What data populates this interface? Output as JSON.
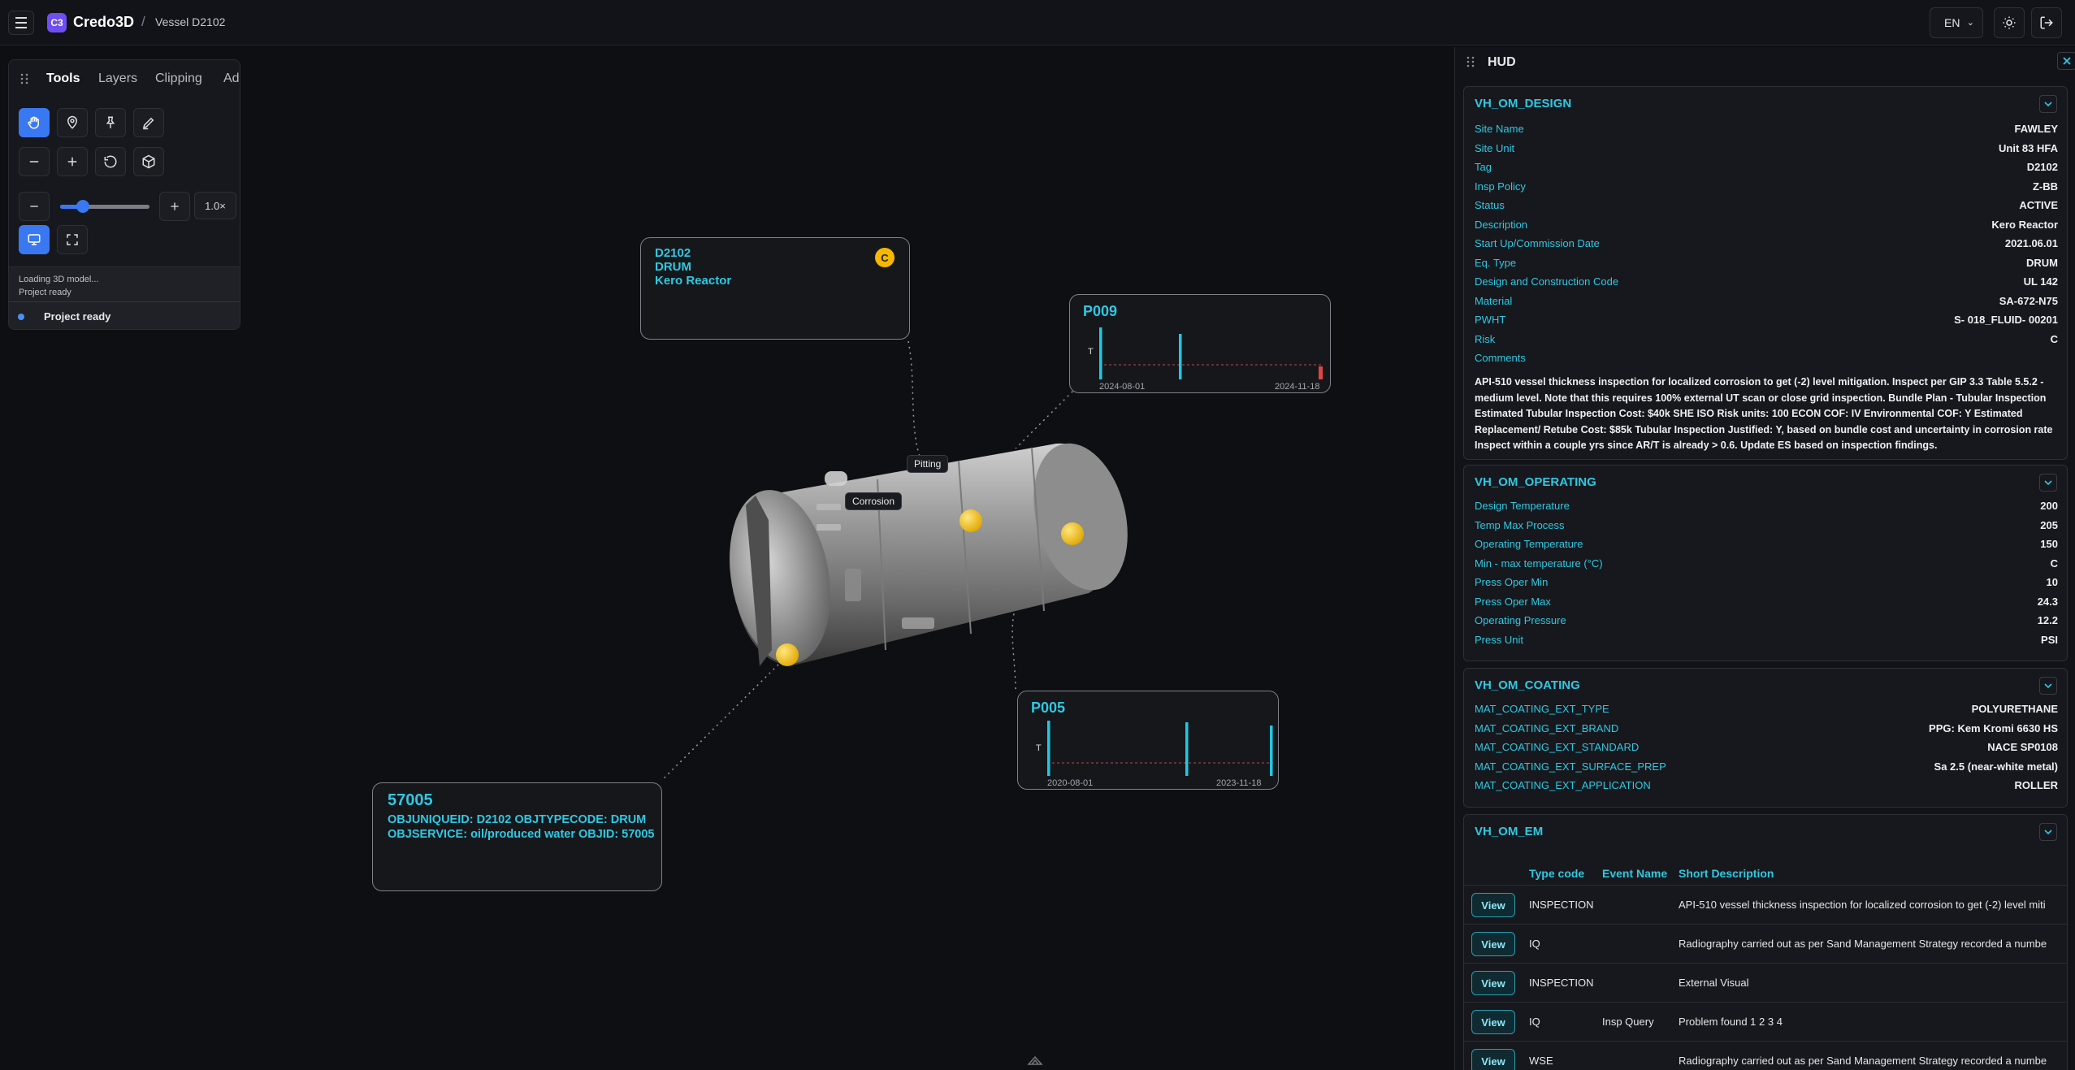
{
  "app": {
    "brand": "Credo3D",
    "breadcrumb": "Vessel D2102",
    "language": "EN",
    "logo_glyph": "C3",
    "accent": "#30c8e2",
    "primary": "#3a78f2"
  },
  "tools_panel": {
    "tabs": [
      "Tools",
      "Layers",
      "Clipping",
      "Ad"
    ],
    "zoom_value": "1.0×",
    "zoom_level_fraction": 0.25,
    "log": [
      "Loading 3D model...",
      "Project ready"
    ],
    "status": "Project ready",
    "icons": [
      "hand-icon",
      "location-pin-icon",
      "pin-icon",
      "pen-icon",
      "minus-icon",
      "plus-icon",
      "rotate-icon",
      "cube-icon",
      "monitor-icon",
      "fullscreen-icon"
    ]
  },
  "viewport": {
    "tags": {
      "pitting": "Pitting",
      "corrosion": "Corrosion"
    },
    "card_d2102": {
      "line1": "D2102",
      "line2": "DRUM",
      "line3": "Kero Reactor",
      "risk_badge": "C"
    },
    "card_p009": {
      "title": "P009",
      "axis": "T",
      "start": "2024-08-01",
      "end": "2024-11-18"
    },
    "card_p005": {
      "title": "P005",
      "axis": "T",
      "start": "2020-08-01",
      "end": "2023-11-18"
    },
    "card_57005": {
      "title": "57005",
      "line1": "OBJUNIQUEID: D2102 OBJTYPECODE: DRUM",
      "line2": "OBJSERVICE: oil/produced water OBJID: 57005"
    }
  },
  "hud": {
    "title": "HUD",
    "design": {
      "title": "VH_OM_DESIGN",
      "rows": [
        {
          "k": "Site Name",
          "v": "FAWLEY"
        },
        {
          "k": "Site Unit",
          "v": "Unit 83 HFA"
        },
        {
          "k": "Tag",
          "v": "D2102"
        },
        {
          "k": "Insp Policy",
          "v": "Z-BB"
        },
        {
          "k": "Status",
          "v": "ACTIVE"
        },
        {
          "k": "Description",
          "v": "Kero Reactor"
        },
        {
          "k": "Start Up/Commission Date",
          "v": "2021.06.01"
        },
        {
          "k": "Eq. Type",
          "v": "DRUM"
        },
        {
          "k": "Design and Construction Code",
          "v": "UL 142"
        },
        {
          "k": "Material",
          "v": "SA-672-N75"
        },
        {
          "k": "PWHT",
          "v": "S- 018_FLUID- 00201"
        },
        {
          "k": "Risk",
          "v": "C"
        },
        {
          "k": "Comments",
          "v": ""
        }
      ],
      "comment": "API-510 vessel thickness inspection for localized corrosion to get (-2) level mitigation. Inspect per GIP 3.3 Table 5.5.2 - medium level. Note that this requires 100% external UT scan or close grid inspection. Bundle Plan - Tubular Inspection Estimated Tubular Inspection Cost: $40k SHE ISO Risk units: 100 ECON COF: IV Environmental COF: Y Estimated Replacement/ Retube Cost: $85k Tubular Inspection Justified: Y, based on bundle cost and uncertainty in corrosion rate Inspect within a couple yrs since AR/T is already > 0.6. Update ES based on inspection findings."
    },
    "operating": {
      "title": "VH_OM_OPERATING",
      "rows": [
        {
          "k": "Design Temperature",
          "v": "200"
        },
        {
          "k": "Temp Max Process",
          "v": "205"
        },
        {
          "k": "Operating Temperature",
          "v": "150"
        },
        {
          "k": "Min - max temperature (°C)",
          "v": "C"
        },
        {
          "k": "Press Oper Min",
          "v": "10"
        },
        {
          "k": "Press Oper Max",
          "v": "24.3"
        },
        {
          "k": "Operating Pressure",
          "v": "12.2"
        },
        {
          "k": "Press Unit",
          "v": "PSI"
        }
      ]
    },
    "coating": {
      "title": "VH_OM_COATING",
      "rows": [
        {
          "k": "MAT_COATING_EXT_TYPE",
          "v": "POLYURETHANE"
        },
        {
          "k": "MAT_COATING_EXT_BRAND",
          "v": "PPG: Kem Kromi 6630 HS"
        },
        {
          "k": "MAT_COATING_EXT_STANDARD",
          "v": "NACE SP0108"
        },
        {
          "k": "MAT_COATING_EXT_SURFACE_PREP",
          "v": "Sa 2.5 (near-white metal)"
        },
        {
          "k": "MAT_COATING_EXT_APPLICATION",
          "v": "ROLLER"
        }
      ]
    },
    "em": {
      "title": "VH_OM_EM",
      "columns": [
        "Type code",
        "Event Name",
        "Short Description"
      ],
      "view_label": "View",
      "rows": [
        {
          "type": "INSPECTION",
          "event": "",
          "desc": "API-510 vessel thickness inspection for localized corrosion to get (-2) level miti"
        },
        {
          "type": "IQ",
          "event": "",
          "desc": "Radiography carried out as per Sand Management Strategy recorded a numbe"
        },
        {
          "type": "INSPECTION",
          "event": "",
          "desc": "External Visual"
        },
        {
          "type": "IQ",
          "event": "Insp Query",
          "desc": "Problem found 1 2 3 4"
        },
        {
          "type": "WSE",
          "event": "",
          "desc": "Radiography carried out as per Sand Management Strategy recorded a numbe"
        }
      ]
    }
  }
}
